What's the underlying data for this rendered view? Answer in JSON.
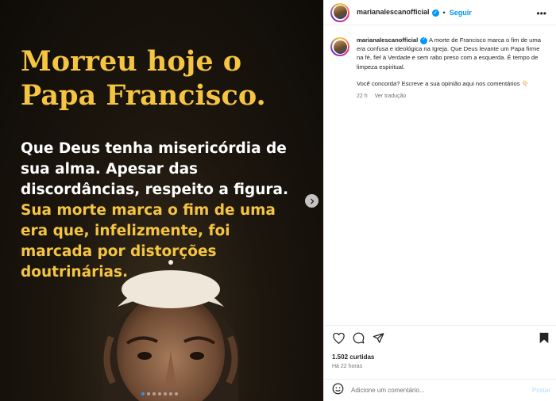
{
  "post": {
    "headline": "Morreu hoje o Papa Francisco.",
    "body_white": "Que Deus tenha misericórdia de sua alma. Apesar das discordâncias, respeito a figura. ",
    "body_yellow": "Sua morte marca o fim de uma era que, infelizmente, foi marcada por distorções doutrinárias.",
    "carousel": {
      "slides": 7,
      "active_index": 0
    },
    "colors": {
      "accent_yellow": "#f5c542",
      "background": "#1c160e"
    }
  },
  "header": {
    "username": "marianalescanofficial",
    "separator": "•",
    "follow_label": "Seguir",
    "more_icon": "more-horizontal-icon"
  },
  "caption": {
    "username": "marianalescanofficial",
    "text": "A morte de Francisco marca o fim de uma era confusa e ideológica na Igreja. Que Deus levante um Papa firme na fé, fiel à Verdade e sem rabo preso com a esquerda. É tempo de limpeza espiritual.",
    "question": "Você concorda? Escreve a sua opinião aqui nos comentários 👇🏻",
    "age": "22 h",
    "translate_label": "Ver tradução"
  },
  "actions": {
    "icons": [
      "heart-icon",
      "comment-icon",
      "share-icon",
      "bookmark-icon"
    ],
    "likes": "1.502 curtidas",
    "time": "Há 22 horas"
  },
  "comment": {
    "placeholder": "Adicione um comentário...",
    "post_label": "Postar"
  }
}
